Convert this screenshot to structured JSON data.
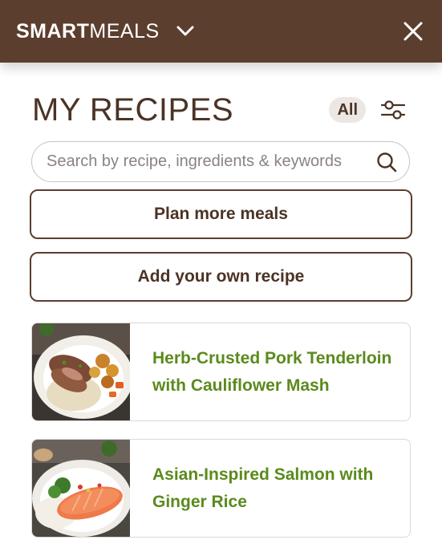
{
  "header": {
    "brand_bold": "SMART",
    "brand_light": "MEALS",
    "brand_menu_icon": "chevron-down-icon",
    "close_icon": "close-icon",
    "background_color": "#5c3e2e"
  },
  "page": {
    "title": "MY RECIPES",
    "filter_pill": "All",
    "filter_icon": "sliders-icon"
  },
  "search": {
    "placeholder": "Search by recipe, ingredients & keywords",
    "value": "",
    "icon": "search-icon"
  },
  "actions": {
    "plan_label": "Plan more meals",
    "add_label": "Add your own recipe"
  },
  "recipes": [
    {
      "title": "Herb-Crusted Pork Tenderloin with Cauliflower Mash",
      "image": "pork-tenderloin-photo"
    },
    {
      "title": "Asian-Inspired Salmon with Ginger Rice",
      "image": "salmon-rice-photo"
    }
  ],
  "colors": {
    "brand_brown": "#5c3e2e",
    "text_brown": "#4b3325",
    "recipe_green": "#5b8a1c",
    "pill_bg": "#ece7e2"
  }
}
